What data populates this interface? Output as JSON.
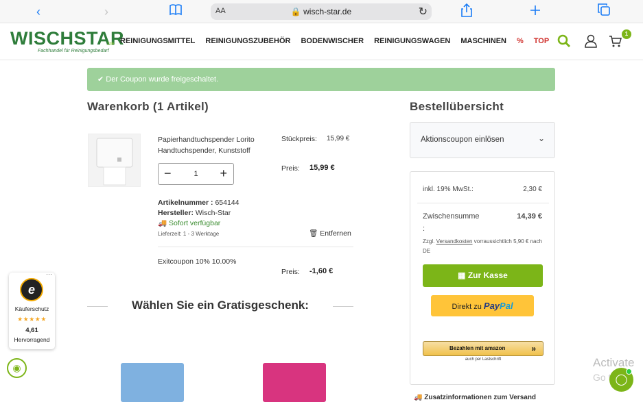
{
  "browser": {
    "aa_label": "AA",
    "url": "wisch-star.de"
  },
  "header": {
    "logo_text": "WISCHSTAR",
    "logo_tld": ".DE",
    "logo_sub": "Fachhandel für Reinigungsbedarf",
    "nav": [
      "REINIGUNGSMITTEL",
      "REINIGUNGSZUBEHÖR",
      "BODENWISCHER",
      "REINIGUNGSWAGEN",
      "MASCHINEN",
      "%",
      "TOP"
    ],
    "cart_count": "1"
  },
  "alert": {
    "text": "Der Coupon wurde freigeschaltet."
  },
  "cart": {
    "title": "Warenkorb (1 Artikel)",
    "item": {
      "name": "Papierhandtuchspender Lorito Handtuchspender, Kunststoff",
      "unit_price_label": "Stückpreis:",
      "unit_price": "15,99 €",
      "quantity": "1",
      "price_label": "Preis:",
      "price": "15,99 €",
      "article_label": "Artikelnummer :",
      "article_no": "654144",
      "maker_label": "Hersteller:",
      "maker": "Wisch-Star",
      "availability": "Sofort verfügbar",
      "delivery": "Lieferzeit: 1 - 3 Werktage",
      "remove_label": "Entfernen"
    },
    "coupon": {
      "name": "Exitcoupon 10% 10.00%",
      "price_label": "Preis:",
      "price": "-1,60 €"
    },
    "gift_heading": "Wählen Sie ein Gratisgeschenk:"
  },
  "summary": {
    "title": "Bestellübersicht",
    "coupon_label": "Aktionscoupon einlösen",
    "vat_label": "inkl. 19% MwSt.:",
    "vat_value": "2,30 €",
    "subtotal_label": "Zwischensumme",
    "subtotal_colon": ":",
    "subtotal_value": "14,39 €",
    "shipping_prefix": "Zzgl.",
    "shipping_link": "Versandkosten",
    "shipping_rest": "vorraussichtlich 5,90 € nach DE",
    "checkout_label": "Zur Kasse",
    "paypal_prefix": "Direkt zu",
    "paypal_1": "Pay",
    "paypal_2": "Pal",
    "amazon_label": "Bezahlen mit amazon",
    "amazon_sub": "auch per Lastschrift",
    "extra_info": "Zusatzinformationen zum Versand"
  },
  "trusted_shops": {
    "label": "Käuferschutz",
    "stars": "★★★★★",
    "score": "4,61",
    "rating_text": "Hervorragend"
  },
  "overlay": {
    "activate_1": "Activate",
    "activate_2": "Go to"
  },
  "colors": {
    "brand_green": "#7cb518",
    "logo_green": "#2f7d3b",
    "alert_green": "#9ed19b",
    "paypal_yellow": "#ffc439",
    "sale_red": "#d0312d"
  }
}
